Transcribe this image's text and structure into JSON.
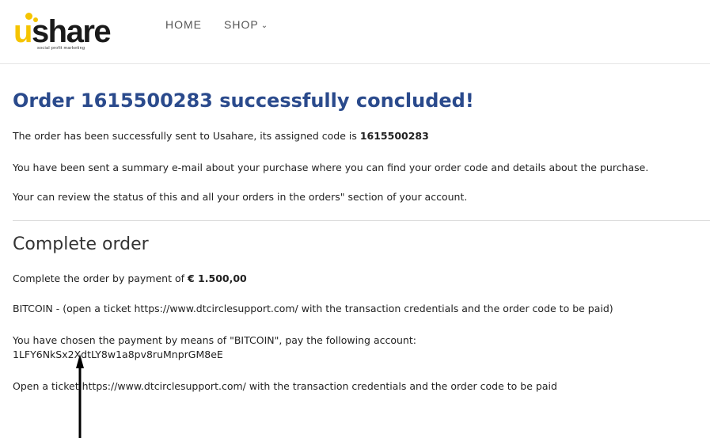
{
  "header": {
    "logo": {
      "text_u": "u",
      "text_rest": "share",
      "tagline": "social profit marketing"
    },
    "nav": [
      {
        "label": "HOME"
      },
      {
        "label": "SHOP"
      }
    ],
    "shop_chevron": "⌄"
  },
  "main": {
    "title": "Order 1615500283 successfully concluded!",
    "sent_text": "The order has been successfully sent to Usahare, its assigned code is ",
    "order_code": "1615500283",
    "email_text": "You have been sent a summary e-mail about your purchase where you can find your order code and details about the purchase.",
    "review_text": "Your can review the status of this and all your orders in the orders\" section of your account.",
    "section_title": "Complete order",
    "payment_text": "Complete the order by payment of ",
    "payment_amount": "€ 1.500,00",
    "bitcoin_text": "BITCOIN - (open a ticket https://www.dtcirclesupport.com/ with the transaction credentials and the order code to be paid)",
    "chosen_text": "You have chosen the payment by means of \"BITCOIN\", pay the following account:",
    "account": "1LFY6NkSx2XdtLY8w1a8pv8ruMnprGM8eE",
    "ticket_text": "Open a ticket https://www.dtcirclesupport.com/ with the transaction credentials and the order code to be paid"
  },
  "colors": {
    "title": "#2a4a8c",
    "brand_yellow": "#f5c400",
    "nav": "#555555",
    "arrow": "#000000"
  },
  "icons": {
    "shop_dropdown": "chevron-down-icon",
    "annotation": "arrow-up-icon"
  }
}
